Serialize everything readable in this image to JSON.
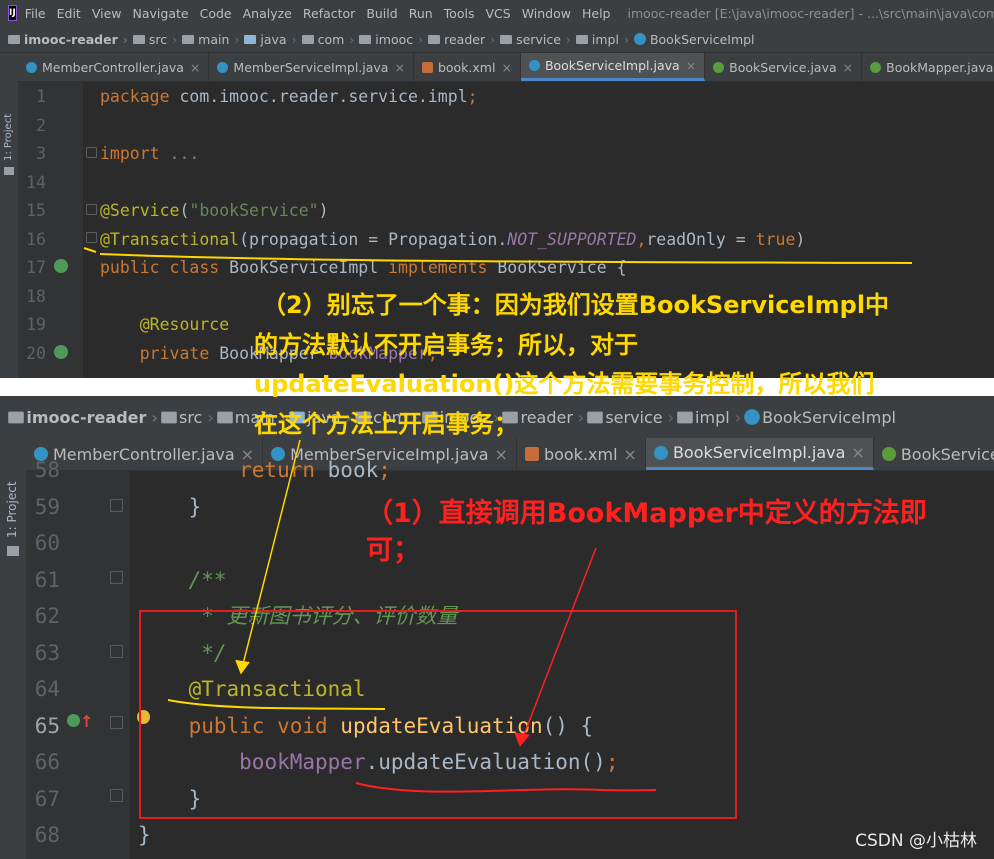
{
  "menubar": {
    "items": [
      "File",
      "Edit",
      "View",
      "Navigate",
      "Code",
      "Analyze",
      "Refactor",
      "Build",
      "Run",
      "Tools",
      "VCS",
      "Window",
      "Help"
    ],
    "title": "imooc-reader [E:\\java\\imooc-reader] - ...\\src\\main\\java\\com\\imooc"
  },
  "breadcrumb": [
    "imooc-reader",
    "src",
    "main",
    "java",
    "com",
    "imooc",
    "reader",
    "service",
    "impl",
    "BookServiceImpl"
  ],
  "tabs": [
    {
      "label": "MemberController.java",
      "type": "class",
      "active": false
    },
    {
      "label": "MemberServiceImpl.java",
      "type": "class",
      "active": false
    },
    {
      "label": "book.xml",
      "type": "xml",
      "active": false
    },
    {
      "label": "BookServiceImpl.java",
      "type": "class",
      "active": true
    },
    {
      "label": "BookService.java",
      "type": "interface",
      "active": false
    },
    {
      "label": "BookMapper.java",
      "type": "interface",
      "active": false
    }
  ],
  "tabs_bottom": [
    {
      "label": "MemberController.java",
      "type": "class",
      "active": false
    },
    {
      "label": "MemberServiceImpl.java",
      "type": "class",
      "active": false
    },
    {
      "label": "book.xml",
      "type": "xml",
      "active": false
    },
    {
      "label": "BookServiceImpl.java",
      "type": "class",
      "active": true
    },
    {
      "label": "BookService.java",
      "type": "interface",
      "active": false
    }
  ],
  "project_strip": "1: Project",
  "editor_top": {
    "lines": [
      {
        "no": "1",
        "parts": [
          {
            "t": "package ",
            "c": "kw"
          },
          {
            "t": "com.imooc.reader.service.impl",
            "c": ""
          },
          {
            "t": ";",
            "c": "kw"
          }
        ]
      },
      {
        "no": "2",
        "parts": []
      },
      {
        "no": "3",
        "parts": [
          {
            "t": "import ",
            "c": "kw"
          },
          {
            "t": "...",
            "c": "gray"
          }
        ]
      },
      {
        "no": "14",
        "parts": []
      },
      {
        "no": "15",
        "parts": [
          {
            "t": "@Service",
            "c": "ann"
          },
          {
            "t": "(",
            "c": ""
          },
          {
            "t": "\"bookService\"",
            "c": "str"
          },
          {
            "t": ")",
            "c": ""
          }
        ]
      },
      {
        "no": "16",
        "parts": [
          {
            "t": "@Transactional",
            "c": "ann"
          },
          {
            "t": "(propagation = Propagation.",
            "c": ""
          },
          {
            "t": "NOT_SUPPORTED",
            "c": "fld ital"
          },
          {
            "t": ",",
            "c": "kw"
          },
          {
            "t": "readOnly = ",
            "c": ""
          },
          {
            "t": "true",
            "c": "kw"
          },
          {
            "t": ")",
            "c": ""
          }
        ]
      },
      {
        "no": "17",
        "parts": [
          {
            "t": "public class ",
            "c": "kw"
          },
          {
            "t": "BookServiceImpl ",
            "c": ""
          },
          {
            "t": "implements ",
            "c": "kw"
          },
          {
            "t": "BookService {",
            "c": ""
          }
        ]
      },
      {
        "no": "18",
        "parts": []
      },
      {
        "no": "19",
        "parts": [
          {
            "t": "    @Resource",
            "c": "ann"
          }
        ]
      },
      {
        "no": "20",
        "parts": [
          {
            "t": "    private ",
            "c": "kw"
          },
          {
            "t": "BookMapper ",
            "c": ""
          },
          {
            "t": "bookMapper",
            "c": "fld"
          },
          {
            "t": ";",
            "c": "kw"
          }
        ]
      }
    ]
  },
  "editor_bottom": {
    "lines": [
      {
        "no": "58",
        "parts": [
          {
            "t": "        return ",
            "c": "kw"
          },
          {
            "t": "book",
            "c": ""
          },
          {
            "t": ";",
            "c": "kw"
          }
        ]
      },
      {
        "no": "59",
        "parts": [
          {
            "t": "    }",
            "c": ""
          }
        ]
      },
      {
        "no": "60",
        "parts": []
      },
      {
        "no": "61",
        "parts": [
          {
            "t": "    /**",
            "c": "com"
          }
        ]
      },
      {
        "no": "62",
        "parts": [
          {
            "t": "     * 更新图书评分、评价数量",
            "c": "com"
          }
        ]
      },
      {
        "no": "63",
        "parts": [
          {
            "t": "     */",
            "c": "com"
          }
        ]
      },
      {
        "no": "64",
        "parts": [
          {
            "t": "    @Transactional",
            "c": "ann"
          }
        ]
      },
      {
        "no": "65",
        "parts": [
          {
            "t": "    public void ",
            "c": "kw"
          },
          {
            "t": "updateEvaluation",
            "c": "fn"
          },
          {
            "t": "() {",
            "c": ""
          }
        ]
      },
      {
        "no": "66",
        "parts": [
          {
            "t": "        ",
            "c": ""
          },
          {
            "t": "bookMapper",
            "c": "fld"
          },
          {
            "t": ".updateEvaluation()",
            "c": ""
          },
          {
            "t": ";",
            "c": "kw"
          }
        ]
      },
      {
        "no": "67",
        "parts": [
          {
            "t": "    }",
            "c": ""
          }
        ]
      },
      {
        "no": "68",
        "parts": [
          {
            "t": "}",
            "c": ""
          }
        ]
      }
    ]
  },
  "annotations": {
    "note2": "（2）别忘了一个事：因为我们设置BookServiceImpl中的方法默认不开启事务；所以，对于updateEvaluation()这个方法需要事务控制，所以我们在这个方法上开启事务；",
    "note2_lines": [
      "（2）别忘了一个事：因为我们设置BookServiceImpl中",
      "的方法默认不开启事务；所以，对于",
      "updateEvaluation()这个方法需要事务控制，所以我们",
      "在这个方法上开启事务；"
    ],
    "note1_lines": [
      "（1）直接调用BookMapper中定义的方法即",
      "可；"
    ]
  },
  "watermark": "CSDN @小枯林",
  "colors": {
    "note_yellow": "#ffd800",
    "note_red": "#ff2020",
    "box_red": "#e0201e"
  }
}
